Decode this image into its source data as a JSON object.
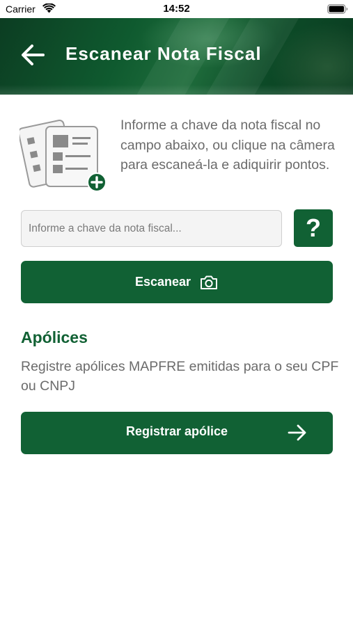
{
  "status_bar": {
    "carrier": "Carrier",
    "time": "14:52",
    "icons": [
      "wifi-icon",
      "battery-icon"
    ]
  },
  "header": {
    "title": "Escanear Nota Fiscal",
    "back_icon": "arrow-left-icon"
  },
  "intro": {
    "illustration_icon": "documents-add-icon",
    "text": "Informe a chave da nota fiscal no campo abaixo, ou clique na câmera para escaneá-la e adiquirir pontos."
  },
  "key_field": {
    "placeholder": "Informe a chave da nota fiscal...",
    "value": ""
  },
  "help_button": {
    "label": "?"
  },
  "scan_button": {
    "label": "Escanear",
    "icon": "camera-icon"
  },
  "policies": {
    "title": "Apólices",
    "description": "Registre apólices MAPFRE emitidas para o seu CPF ou CNPJ",
    "button_label": "Registrar apólice",
    "button_icon": "arrow-right-icon"
  },
  "colors": {
    "brand_green": "#116134",
    "body_text": "#6b6b6b",
    "background": "#ffffff"
  }
}
